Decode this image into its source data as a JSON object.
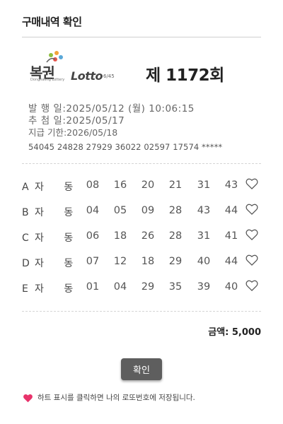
{
  "header": {
    "title": "구매내역 확인"
  },
  "logo": {
    "brand": "복권",
    "brand_sub": "Donghaeng Lottery",
    "lotto": "Lotto",
    "lotto_sub": "6/45"
  },
  "round": {
    "title": "제 1172회"
  },
  "info": {
    "issue": "발 행 일:2025/05/12 (월) 10:06:15",
    "draw": "추 첨 일:2025/05/17",
    "deadline": "지급 기한:2026/05/18"
  },
  "serials": "54045 24828 27929 36022 02597 17574 *****",
  "games": [
    {
      "letter": "A",
      "mode": "자 동",
      "numbers": [
        "08",
        "16",
        "20",
        "21",
        "31",
        "43"
      ]
    },
    {
      "letter": "B",
      "mode": "자 동",
      "numbers": [
        "04",
        "05",
        "09",
        "28",
        "43",
        "44"
      ]
    },
    {
      "letter": "C",
      "mode": "자 동",
      "numbers": [
        "06",
        "18",
        "26",
        "28",
        "31",
        "41"
      ]
    },
    {
      "letter": "D",
      "mode": "자 동",
      "numbers": [
        "07",
        "12",
        "18",
        "29",
        "40",
        "44"
      ]
    },
    {
      "letter": "E",
      "mode": "자 동",
      "numbers": [
        "01",
        "04",
        "29",
        "35",
        "39",
        "40"
      ]
    }
  ],
  "amount": "금액: 5,000",
  "confirm_label": "확인",
  "note": "하트 표시를 클릭하면 나의 로또번호에 저장됩니다.",
  "colors": {
    "heart": "#e8336b",
    "button": "#5e5e5e"
  }
}
